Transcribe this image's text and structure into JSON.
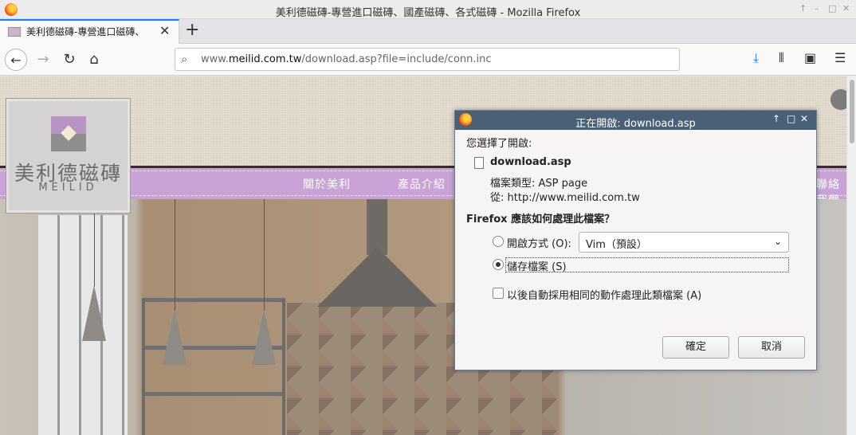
{
  "window": {
    "title": "美利德磁磚-專營進口磁磚、國產磁磚、各式磁磚 - Mozilla Firefox",
    "controls": [
      "↑",
      "–",
      "□",
      "✕"
    ]
  },
  "tab": {
    "title": "美利德磁磚-專營進口磁磚、",
    "close": "✕",
    "new_tab": "+"
  },
  "navbar": {
    "back": "←",
    "forward": "→",
    "reload": "↻",
    "home": "⌂",
    "url_prefix": "www.",
    "url_domain": "meilid.com.tw",
    "url_path": "/download.asp?file=include/conn.inc",
    "downloads_icon": "⤓",
    "library_icon": "⫴",
    "sidebar_icon": "▣",
    "menu_icon": "☰"
  },
  "page": {
    "logo_cn": "美利德磁磚",
    "logo_en": "MEILID",
    "menu": [
      "關於美利",
      "產品介紹",
      "聯絡我們"
    ]
  },
  "dialog": {
    "title": "正在開啟: download.asp",
    "heading": "您選擇了開啟:",
    "filename": "download.asp",
    "type_label": "檔案類型:",
    "type_value": "ASP page",
    "from_label": "從:",
    "from_value": "http://www.meilid.com.tw",
    "question": "Firefox 應該如何處理此檔案？",
    "open_with_label": "開啟方式",
    "open_with_key": "(O):",
    "open_with_key_letter": "O",
    "open_with_app": "Vim（預設）",
    "save_label": "儲存檔案",
    "save_key": "(S)",
    "remember_label": "以後自動採用相同的動作處理此類檔案",
    "remember_key": "(A)",
    "ok": "確定",
    "cancel": "取消",
    "save_selected": true,
    "remember_checked": false
  }
}
